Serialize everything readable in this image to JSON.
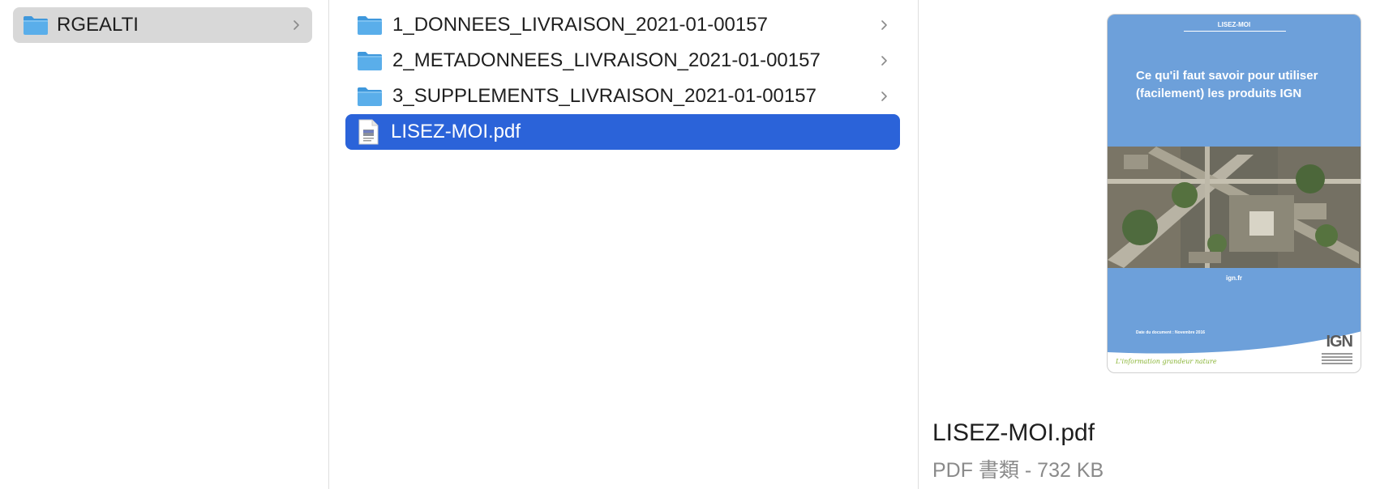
{
  "column1": {
    "items": [
      {
        "label": "RGEALTI",
        "icon": "folder-icon",
        "has_children": true,
        "state": "selected-inactive"
      }
    ]
  },
  "column2": {
    "items": [
      {
        "label": "1_DONNEES_LIVRAISON_2021-01-00157",
        "icon": "folder-icon",
        "has_children": true
      },
      {
        "label": "2_METADONNEES_LIVRAISON_2021-01-00157",
        "icon": "folder-icon",
        "has_children": true
      },
      {
        "label": "3_SUPPLEMENTS_LIVRAISON_2021-01-00157",
        "icon": "folder-icon",
        "has_children": true
      },
      {
        "label": "LISEZ-MOI.pdf",
        "icon": "pdf-document-icon",
        "has_children": false,
        "state": "selected-active"
      }
    ]
  },
  "preview": {
    "thumbnail": {
      "label": "LISEZ-MOI",
      "heading_line1": "Ce qu'il faut savoir pour utiliser",
      "heading_line2": "(facilement) les produits IGN",
      "site": "ign.fr",
      "date": "Date du document : Novembre 2016",
      "slogan": "L'information grandeur nature",
      "logo": "IGN"
    },
    "file_name": "LISEZ-MOI.pdf",
    "file_info": "PDF 書類 - 732 KB"
  },
  "colors": {
    "selection_active": "#2b63d9",
    "selection_inactive": "#d8d8d8",
    "folder_blue": "#5aaeea",
    "thumb_blue": "#6da0da"
  }
}
